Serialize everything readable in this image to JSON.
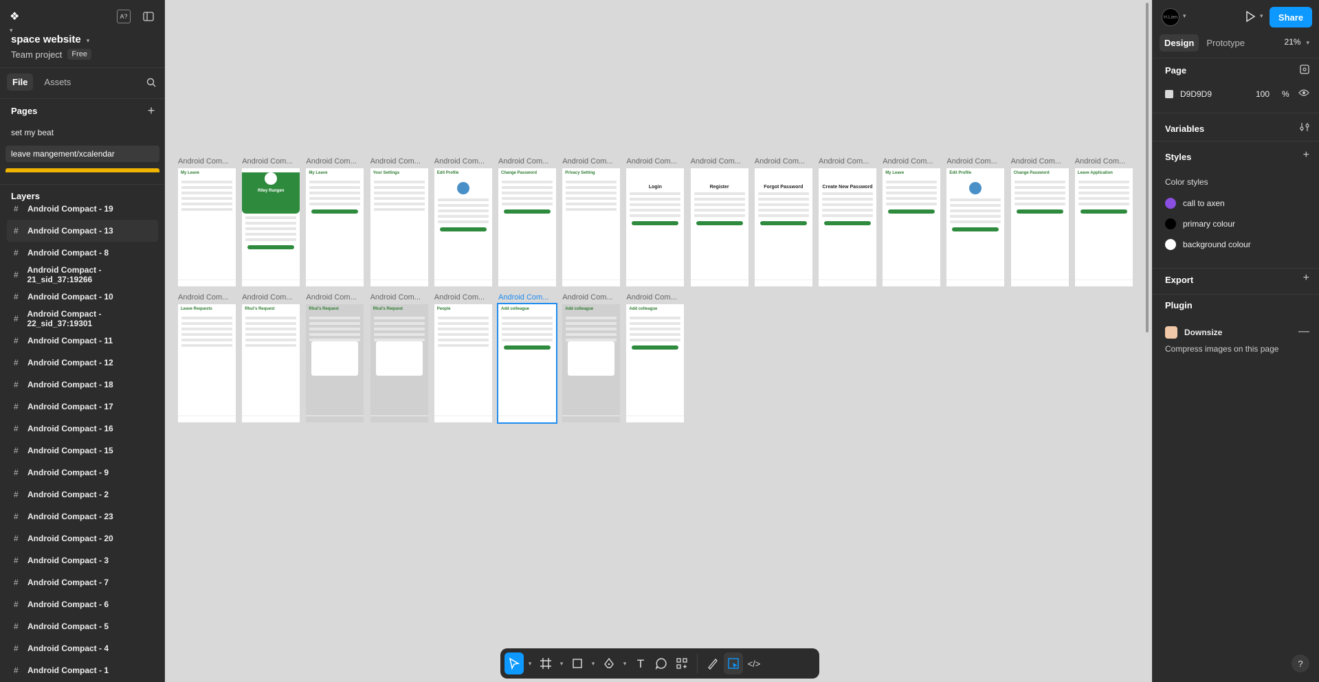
{
  "left": {
    "project_name": "space website",
    "project_type": "Team project",
    "plan_badge": "Free",
    "tabs": [
      "File",
      "Assets"
    ],
    "pages_title": "Pages",
    "pages": [
      "set my beat",
      "leave mangement/xcalendar"
    ],
    "layers_title": "Layers",
    "layers": [
      "Android Compact - 19",
      "Android Compact - 13",
      "Android Compact - 8",
      "Android Compact - 21_sid_37:19266",
      "Android Compact - 10",
      "Android Compact - 22_sid_37:19301",
      "Android Compact - 11",
      "Android Compact - 12",
      "Android Compact - 18",
      "Android Compact - 17",
      "Android Compact - 16",
      "Android Compact - 15",
      "Android Compact - 9",
      "Android Compact - 2",
      "Android Compact - 23",
      "Android Compact - 20",
      "Android Compact - 3",
      "Android Compact - 7",
      "Android Compact - 6",
      "Android Compact - 5",
      "Android Compact - 4",
      "Android Compact - 1"
    ]
  },
  "canvas": {
    "frame_label": "Android Com...",
    "row1": [
      {
        "title": "My Leave",
        "kind": "list"
      },
      {
        "title": "Riley Rungen",
        "kind": "hero"
      },
      {
        "title": "My Leave",
        "kind": "form"
      },
      {
        "title": "Your Settings",
        "kind": "list"
      },
      {
        "title": "Edit Profile",
        "kind": "profile"
      },
      {
        "title": "Change Password",
        "kind": "form"
      },
      {
        "title": "Privacy Setting",
        "kind": "list"
      },
      {
        "title": "Login",
        "kind": "center"
      },
      {
        "title": "Register",
        "kind": "center"
      },
      {
        "title": "Forgot Password",
        "kind": "center"
      },
      {
        "title": "Create New Password",
        "kind": "center"
      },
      {
        "title": "My Leave",
        "kind": "form"
      },
      {
        "title": "Edit Profile",
        "kind": "profile"
      },
      {
        "title": "Change Password",
        "kind": "form"
      },
      {
        "title": "Leave Application",
        "kind": "form"
      }
    ],
    "row2": [
      {
        "title": "Leave Requests",
        "kind": "list"
      },
      {
        "title": "Rhul's Request",
        "kind": "list"
      },
      {
        "title": "Rhul's Request",
        "kind": "dialog"
      },
      {
        "title": "Rhul's Request",
        "kind": "dialog"
      },
      {
        "title": "People",
        "kind": "list"
      },
      {
        "title": "Add colleague",
        "kind": "form"
      },
      {
        "title": "Add colleague",
        "kind": "dialog"
      },
      {
        "title": "Add colleague",
        "kind": "form"
      }
    ]
  },
  "toolbar": {
    "tools": [
      "move-tool",
      "frame-tool",
      "shape-tool",
      "pen-tool",
      "text-tool",
      "comment-tool",
      "actions-tool",
      "draw-mode",
      "design-mode",
      "dev-mode"
    ]
  },
  "right": {
    "avatar_text": "H.Lien",
    "share_label": "Share",
    "tabs": [
      "Design",
      "Prototype"
    ],
    "zoom": "21%",
    "page_title": "Page",
    "page_color_hex": "D9D9D9",
    "page_opacity": "100",
    "page_opacity_unit": "%",
    "variables_title": "Variables",
    "styles_title": "Styles",
    "color_styles_title": "Color styles",
    "color_styles": [
      {
        "name": "call to axen",
        "color": "#8a4fe0"
      },
      {
        "name": "primary colour",
        "color": "#000000"
      },
      {
        "name": "background colour",
        "color": "#ffffff"
      }
    ],
    "export_title": "Export",
    "plugin_title": "Plugin",
    "plugin_name": "Downsize",
    "plugin_desc": "Compress images on this page",
    "help": "?"
  },
  "colors": {
    "accent": "#0d99ff",
    "green": "#2e8b3e",
    "panel": "#2c2c2c",
    "canvas": "#d9d9d9"
  }
}
